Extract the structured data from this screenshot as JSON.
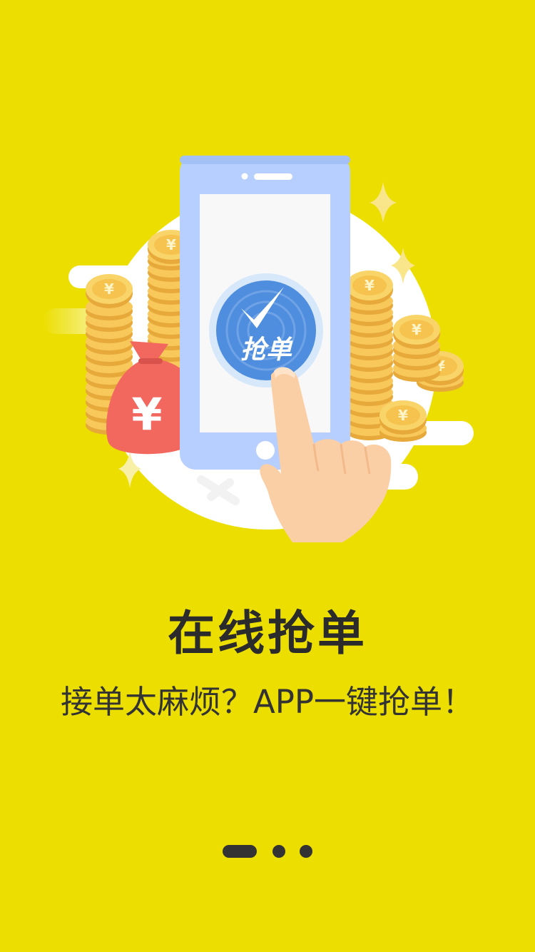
{
  "illustration": {
    "button_text": "抢单",
    "currency_symbol": "¥"
  },
  "title": "在线抢单",
  "subtitle": "接单太麻烦？APP一键抢单！",
  "pager": {
    "total": 3,
    "active_index": 0
  },
  "colors": {
    "background": "#ECDF00",
    "phone": "#B6CFFF",
    "grab_button": "#4F8EDE",
    "money_bag": "#F2685F",
    "coin": "#F7CB5B"
  }
}
